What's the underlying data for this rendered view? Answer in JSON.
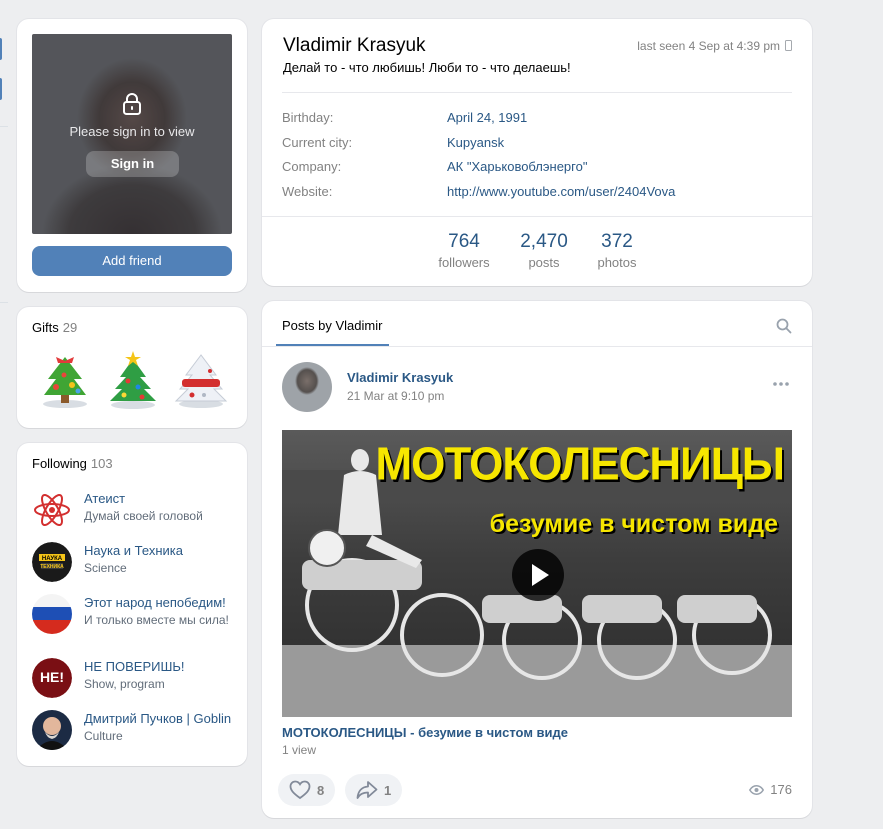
{
  "sidebar_avatar": {
    "locked_text": "Please sign in to view",
    "sign_in_label": "Sign in",
    "add_friend_label": "Add friend"
  },
  "gifts": {
    "title": "Gifts",
    "count": "29",
    "items": [
      "christmas-tree-gift-icon",
      "christmas-tree-gift-icon",
      "snowy-tree-gift-icon"
    ]
  },
  "following": {
    "title": "Following",
    "count": "103",
    "items": [
      {
        "name": "Атеист",
        "desc": "Думай своей головой",
        "icon": "atom-logo-icon"
      },
      {
        "name": "Наука и Техника",
        "desc": "Science",
        "icon": "nauka-tehnika-logo-icon"
      },
      {
        "name": "Этот народ непобедим!",
        "desc": "И только вместе мы сила!",
        "icon": "russian-flag-icon"
      },
      {
        "name": "НЕ ПОВЕРИШЬ!",
        "desc": "Show, program",
        "icon": "ne-poverish-logo-icon"
      },
      {
        "name": "Дмитрий Пучков | Goblin",
        "desc": "Culture",
        "icon": "person-avatar-icon"
      }
    ]
  },
  "profile": {
    "name": "Vladimir Krasyuk",
    "last_seen": "last seen 4 Sep at 4:39 pm",
    "status": "Делай то - что любишь! Люби то - что делаешь!",
    "info": [
      {
        "label": "Birthday:",
        "value": "April 24, 1991"
      },
      {
        "label": "Current city:",
        "value": "Kupyansk"
      },
      {
        "label": "Company:",
        "value": "АК \"Харьковоблэнерго\""
      },
      {
        "label": "Website:",
        "value": "http://www.youtube.com/user/2404Vova"
      }
    ],
    "counters": [
      {
        "num": "764",
        "label": "followers"
      },
      {
        "num": "2,470",
        "label": "posts"
      },
      {
        "num": "372",
        "label": "photos"
      }
    ]
  },
  "posts": {
    "tab_label": "Posts by Vladimir",
    "post": {
      "author": "Vladimir Krasyuk",
      "date": "21 Mar at 9:10 pm",
      "video_title_big": "МОТОКОЛЕСНИЦЫ",
      "video_subtitle": "безумие в чистом виде",
      "video_link": "МОТОКОЛЕСНИЦЫ - безумие в чистом виде",
      "video_views": "1 view",
      "likes": "8",
      "shares": "1",
      "views": "176"
    }
  },
  "colors": {
    "accent": "#5181b8",
    "link": "#2a5885",
    "muted": "#828282",
    "background": "#edeef0",
    "video_title": "#f6e600"
  }
}
